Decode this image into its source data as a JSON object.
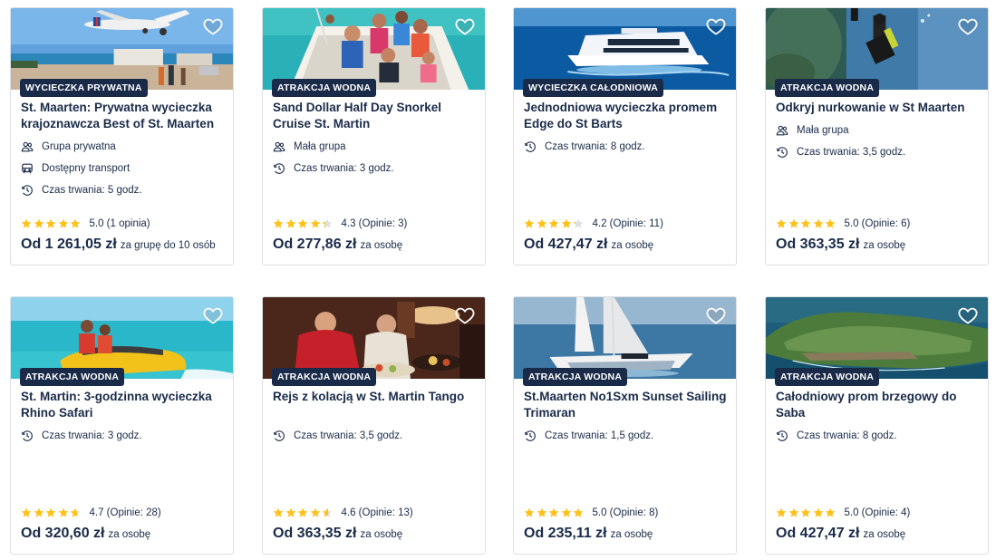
{
  "cards": [
    {
      "badge": "WYCIECZKA PRYWATNA",
      "title": "St. Maarten: Prywatna wycieczka krajoznawcza Best of St. Maarten",
      "features": [
        {
          "icon": "group-icon",
          "text": "Grupa prywatna"
        },
        {
          "icon": "bus-icon",
          "text": "Dostępny transport"
        },
        {
          "icon": "clock-icon",
          "text": "Czas trwania: 5 godz."
        }
      ],
      "rating": 5.0,
      "rating_text": "5.0 (1 opinia)",
      "price": "Od 1 261,05 zł",
      "unit": "za grupę do 10 osób",
      "image": "plane-beach"
    },
    {
      "badge": "ATRAKCJA WODNA",
      "title": "Sand Dollar Half Day Snorkel Cruise St. Martin",
      "features": [
        {
          "icon": "group-icon",
          "text": "Mała grupa"
        },
        {
          "icon": "clock-icon",
          "text": "Czas trwania: 3 godz."
        }
      ],
      "rating": 4.3,
      "rating_text": "4.3 (Opinie: 3)",
      "price": "Od 277,86 zł",
      "unit": "za osobę",
      "image": "boat-people"
    },
    {
      "badge": "WYCIECZKA CAŁODNIOWA",
      "title": "Jednodniowa wycieczka promem Edge do St Barts",
      "features": [
        {
          "icon": "clock-icon",
          "text": "Czas trwania: 8 godz."
        }
      ],
      "rating": 4.2,
      "rating_text": "4.2 (Opinie: 11)",
      "price": "Od 427,47 zł",
      "unit": "za osobę",
      "image": "ferry"
    },
    {
      "badge": "ATRAKCJA WODNA",
      "title": "Odkryj nurkowanie w St Maarten",
      "features": [
        {
          "icon": "group-icon",
          "text": "Mała grupa"
        },
        {
          "icon": "clock-icon",
          "text": "Czas trwania: 3,5 godz."
        }
      ],
      "rating": 5.0,
      "rating_text": "5.0 (Opinie: 6)",
      "price": "Od 363,35 zł",
      "unit": "za osobę",
      "image": "diver"
    },
    {
      "badge": "ATRAKCJA WODNA",
      "title": "St. Martin: 3-godzinna wycieczka Rhino Safari",
      "features": [
        {
          "icon": "clock-icon",
          "text": "Czas trwania: 3 godz."
        }
      ],
      "rating": 4.7,
      "rating_text": "4.7 (Opinie: 28)",
      "price": "Od 320,60 zł",
      "unit": "za osobę",
      "image": "rhino-boat"
    },
    {
      "badge": "ATRAKCJA WODNA",
      "title": "Rejs z kolacją w St. Martin Tango",
      "features": [
        {
          "icon": "clock-icon",
          "text": "Czas trwania: 3,5 godz."
        }
      ],
      "rating": 4.6,
      "rating_text": "4.6 (Opinie: 13)",
      "price": "Od 363,35 zł",
      "unit": "za osobę",
      "image": "dinner"
    },
    {
      "badge": "ATRAKCJA WODNA",
      "title": "St.Maarten No1Sxm Sunset Sailing Trimaran",
      "features": [
        {
          "icon": "clock-icon",
          "text": "Czas trwania: 1,5 godz."
        }
      ],
      "rating": 5.0,
      "rating_text": "5.0 (Opinie: 8)",
      "price": "Od 235,11 zł",
      "unit": "za osobę",
      "image": "trimaran"
    },
    {
      "badge": "ATRAKCJA WODNA",
      "title": "Całodniowy prom brzegowy do Saba",
      "features": [
        {
          "icon": "clock-icon",
          "text": "Czas trwania: 8 godz."
        }
      ],
      "rating": 5.0,
      "rating_text": "5.0 (Opinie: 4)",
      "price": "Od 427,47 zł",
      "unit": "za osobę",
      "image": "island"
    }
  ],
  "colors": {
    "primary": "#1a2b49",
    "star": "#ffc21a",
    "star_empty": "#dcdfe4",
    "border": "#dcdfe4"
  }
}
